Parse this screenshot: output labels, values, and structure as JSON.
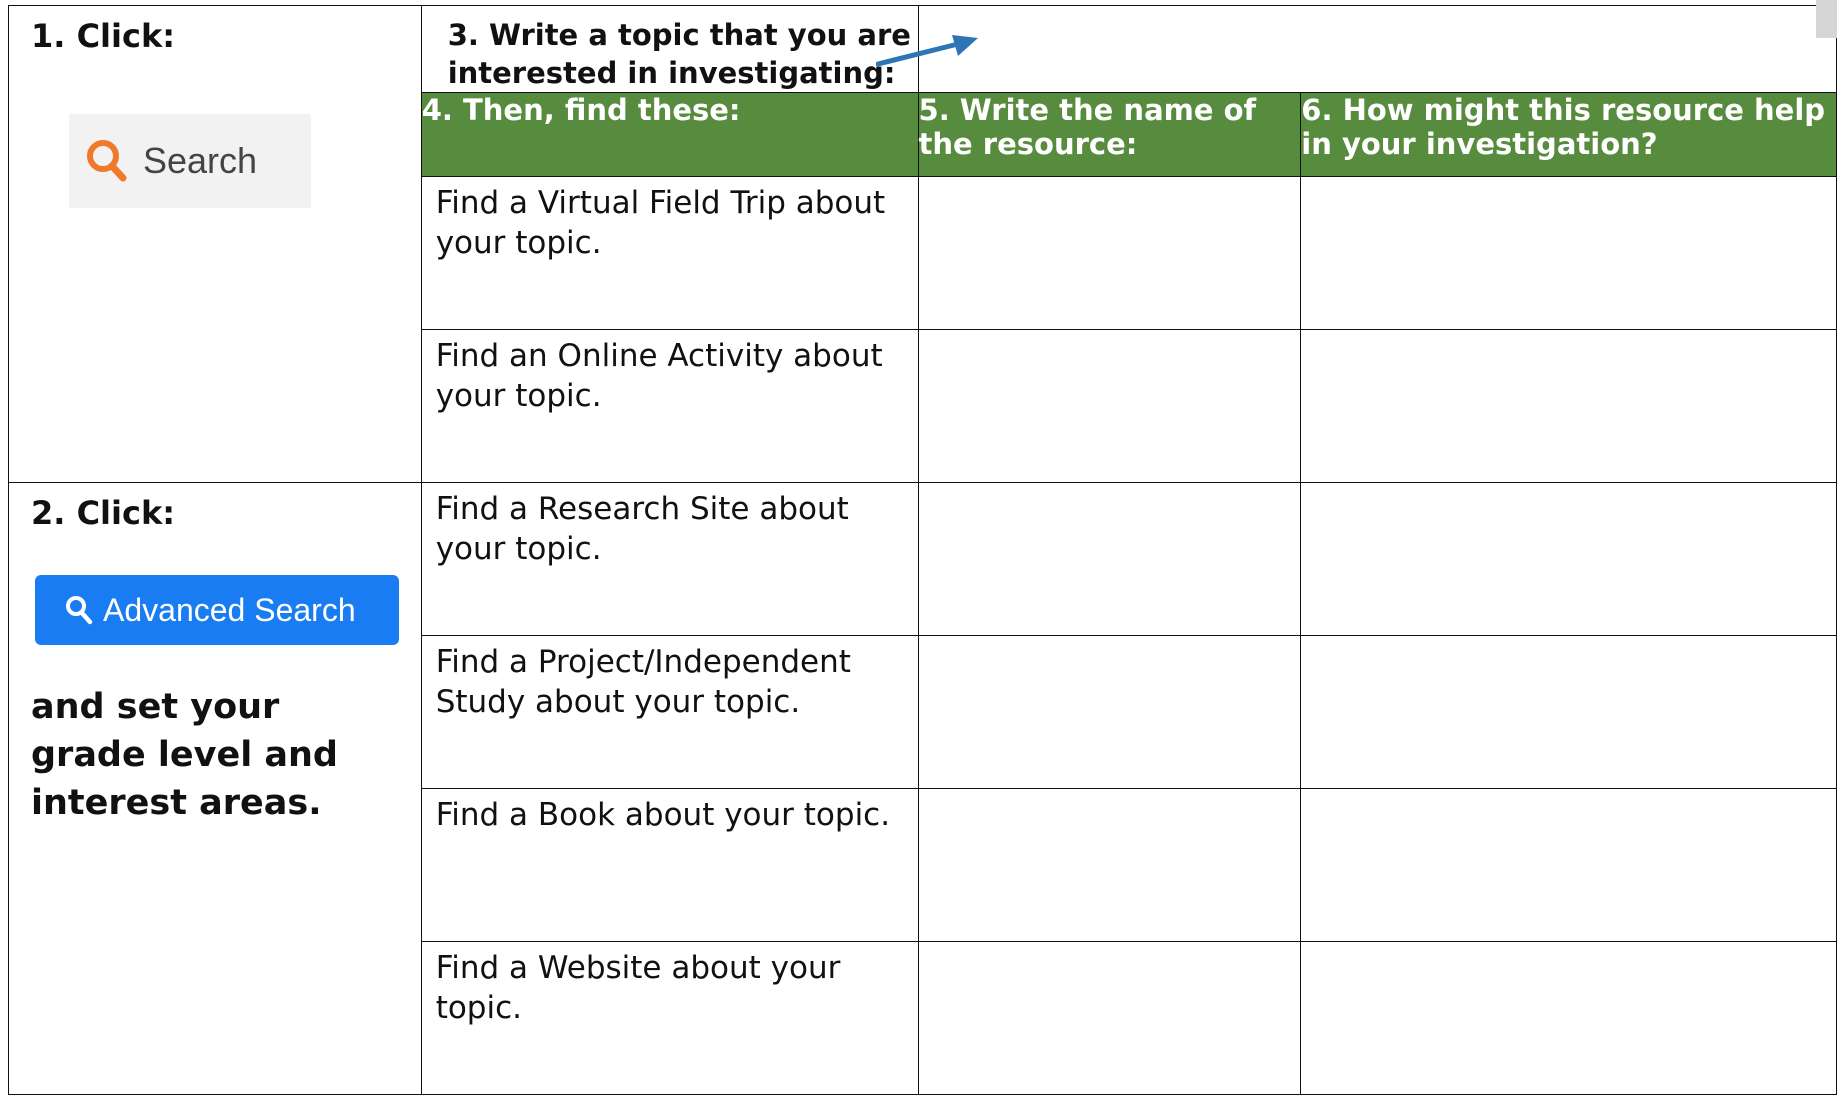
{
  "step1": {
    "label": "1.  Click:",
    "search_chip_label": "Search"
  },
  "step2": {
    "label": "2.  Click:",
    "button_label": "Advanced Search",
    "instructions": "and set your grade level and interest areas."
  },
  "step3": {
    "prompt": "3.  Write a topic that you are interested in investigating:"
  },
  "headers": {
    "col4": "4.  Then, find these:",
    "col5": "5.  Write the name of the resource:",
    "col6": "6.  How might this resource help in your investigation?"
  },
  "rows": [
    {
      "prompt": "Find a Virtual Field Trip about your topic."
    },
    {
      "prompt": "Find an Online Activity about your topic."
    },
    {
      "prompt": "Find a Research Site about your topic."
    },
    {
      "prompt": "Find a Project/Independent Study about your topic."
    },
    {
      "prompt": "Find a Book about your topic."
    },
    {
      "prompt": "Find a Website about your topic."
    }
  ],
  "colors": {
    "header_green": "#578b3d",
    "search_icon_orange": "#f07a2c",
    "button_blue": "#1a7cf2",
    "arrow_blue": "#2e75b6"
  },
  "icons": [
    "search-icon",
    "arrow-icon"
  ]
}
